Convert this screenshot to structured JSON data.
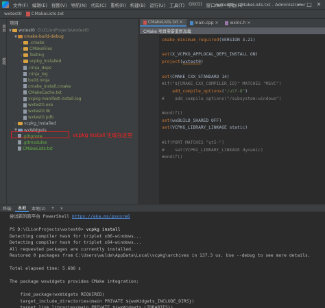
{
  "titlebar": {
    "menus": [
      "文件(F)",
      "编辑(E)",
      "视图(V)",
      "导航(N)",
      "代码(C)",
      "重构(R)",
      "构建(B)",
      "运行(U)",
      "工具(T)",
      "Git(G)",
      "窗口(W)",
      "帮助(H)"
    ],
    "title": "wxtest0 - CMakeLists.txt - Administrator"
  },
  "navbar": {
    "project": "wxtest0",
    "file": "CMakeLists.txt"
  },
  "left_strip": {
    "project_tab": "项目",
    "structure_tab": "结构"
  },
  "project_panel": {
    "header": "项目",
    "root": "wxtest0",
    "root_path": "D:\\CLionProjects\\wxtest0",
    "items": [
      {
        "label": "cmake-build-debug",
        "kind": "folder-orange"
      },
      {
        "label": ".cmake",
        "kind": "folder"
      },
      {
        "label": "CMakeFiles",
        "kind": "folder"
      },
      {
        "label": "Testing",
        "kind": "folder"
      },
      {
        "label": "vcpkg_installed",
        "kind": "folder"
      },
      {
        "label": ".ninja_deps",
        "kind": "file"
      },
      {
        "label": ".ninja_log",
        "kind": "file"
      },
      {
        "label": "build.ninja",
        "kind": "file"
      },
      {
        "label": "cmake_install.cmake",
        "kind": "file"
      },
      {
        "label": "CMakeCache.txt",
        "kind": "file"
      },
      {
        "label": "vcpkg-manifest-install.log",
        "kind": "file"
      },
      {
        "label": "wxtest0.exe",
        "kind": "file"
      },
      {
        "label": "wxtest0.ilk",
        "kind": "file"
      },
      {
        "label": "wxtest0.pdb",
        "kind": "file"
      },
      {
        "label": "vcpkg_installed",
        "kind": "folder"
      },
      {
        "label": "wxWidgets",
        "kind": "folder-blue"
      },
      {
        "label": ".gitignore",
        "kind": "file"
      },
      {
        "label": ".gitmodules",
        "kind": "file"
      },
      {
        "label": "CMakeLists.txt",
        "kind": "file"
      }
    ],
    "annotation": "vcpkg install 生成在这里"
  },
  "editor": {
    "tabs": [
      {
        "label": "CMakeLists.txt",
        "active": true
      },
      {
        "label": "main.cpp",
        "active": false
      },
      {
        "label": "wxinc.h",
        "active": false
      }
    ],
    "banner": "CMake 项目需要重新加载",
    "code_lines": [
      "cmake_minimum_required(VERSION 3.21)",
      "",
      "set(X_VCPKG_APPLOCAL_DEPS_INSTALL ON)",
      "project(wxtest0)",
      "",
      "set(CMAKE_CXX_STANDARD 14)",
      "#if(\"${CMAKE_CXX_COMPILER_ID}\" MATCHES \"MSVC\")",
      "    add_compile_options(\"/utf-8\")",
      "#    add_compile_options(\"/subsystem:windows\")",
      "",
      "#endif()",
      "set(wxBUILD_SHARED OFF)",
      "set(VCPKG_LIBRARY_LINKAGE static)",
      "",
      "#if(PORT MATCHES \"qt5-\")",
      "#    set(VCPKG_LIBRARY_LINKAGE dynamic)",
      "#endif()"
    ]
  },
  "terminal": {
    "tabs": [
      "终端:",
      "本地",
      "本地(2)",
      "+",
      "∨"
    ],
    "lines": [
      "尝试新的跨平台 PowerShell https://aka.ms/pscore6",
      "",
      "PS D:\\CLionProjects\\wxtest0> vcpkg install",
      "Detecting compiler hash for triplet x86-windows...",
      "Detecting compiler hash for triplet x64-windows...",
      "All requested packages are currently installed.",
      "Restored 0 packages from C:\\Users\\wulda\\AppData\\Local\\vcpkg\\archives in 137.3 us. Use --debug to see more details.",
      "",
      "Total elapsed time: 5.686 s",
      "",
      "The package wxwidgets provides CMake integration:",
      "",
      "    find_package(wxWidgets REQUIRED)",
      "    target_include_directories(main PRIVATE ${wxWidgets_INCLUDE_DIRS})",
      "    target_link_libraries(main PRIVATE ${wxWidgets_LIBRARIES})",
      "",
      "PS D:\\CLionProjects\\wxtest0> "
    ],
    "link": "https://aka.ms/pscore6"
  },
  "window_buttons": [
    "—",
    "□",
    "✕"
  ],
  "colors": {
    "accent": "#4a88c7",
    "annotation": "#ff2020"
  }
}
